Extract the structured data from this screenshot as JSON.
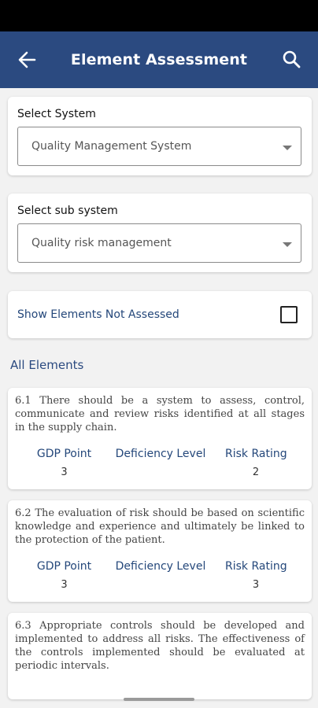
{
  "header": {
    "title": "Element Assessment",
    "back_icon": "arrow-left-icon",
    "search_icon": "search-icon"
  },
  "system": {
    "label": "Select System",
    "value": "Quality Management System"
  },
  "subsystem": {
    "label": "Select sub system",
    "value": "Quality risk management"
  },
  "filter": {
    "label": "Show Elements Not Assessed",
    "checked": false
  },
  "elements_title": "All Elements",
  "metric_labels": {
    "gdp": "GDP Point",
    "deficiency": "Deficiency Level",
    "risk": "Risk Rating"
  },
  "elements": [
    {
      "text": "6.1 There should be a system to assess, control, communicate and review risks identified at all stages in the supply chain.",
      "gdp": "3",
      "deficiency": "",
      "risk": "2"
    },
    {
      "text": "6.2 The evaluation of risk should be based on scientific knowledge and experience and ultimately be linked to the protection of the patient.",
      "gdp": "3",
      "deficiency": "",
      "risk": "3"
    },
    {
      "text": "6.3 Appropriate controls should be developed and implemented to address all risks. The effectiveness of the controls implemented should be evaluated at periodic intervals."
    }
  ],
  "colors": {
    "appbar": "#2b4a80",
    "accent_text": "#24477a"
  }
}
